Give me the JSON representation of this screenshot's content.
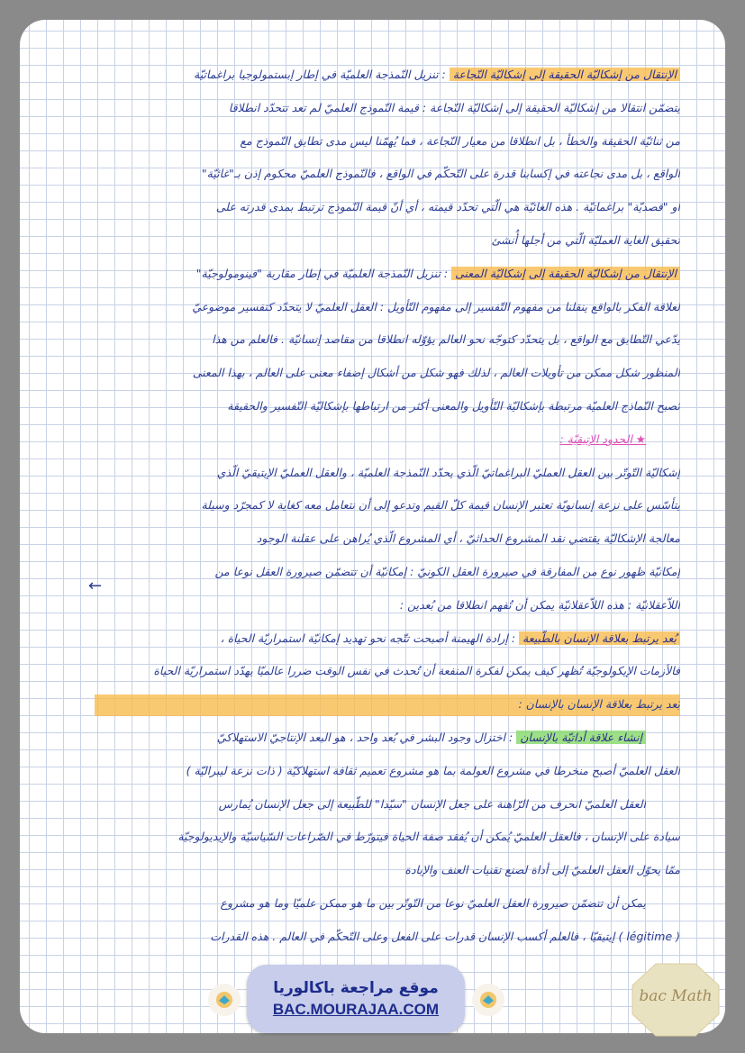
{
  "lines": [
    {
      "text": "الإنتقال من إشكاليّة الحقيقة إلى إشكاليّة النّجاعة : تنزيل النّمذجة العلميّة في إطار إبستمولوجيا براغماتيّة",
      "highlight": "الإنتقال من إشكاليّة الحقيقة إلى إشكاليّة النّجاعة"
    },
    {
      "text": "يتضمّن انتقالا من إشكاليّة الحقيقة إلى إشكاليّة النّجاعة : قيمة النّموذج العلميّ لم تعد تتحدّد انطلاقا"
    },
    {
      "text": "من ثنائيّة الحقيقة والخطأ ، بل انطلاقا من معيار النّجاعة ، فما يُهمّنا ليس مدى تطابق النّموذج مع"
    },
    {
      "text": "الواقع ، بل مدى نجاعته في إكسابنا قدرة على التّحكّم في الواقع ، فالنّموذج العلميّ محكوم إذن بـ\"غائيّة\""
    },
    {
      "text": "أو \"قصديّة\" براغماتيّة . هذه الغائيّة هي الّتي تحدّد قيمته ، أي أنّ قيمة النّموذج ترتبط بمدى قدرته على"
    },
    {
      "text": "تحقيق الغاية العمليّة الّتي من أجلها أُنشئ"
    },
    {
      "text": "الإنتقال من إشكاليّة الحقيقة إلى إشكاليّة المعنى : تنزيل النّمذجة العلميّة في إطار مقاربة \"فينومولوجيّة\"",
      "highlight": "الإنتقال من إشكاليّة الحقيقة إلى إشكاليّة المعنى"
    },
    {
      "text": "لعلاقة الفكر بالواقع ينقلنا من مفهوم التّفسير إلى مفهوم التّأويل : العقل العلميّ لا يتحدّد كتفسير موضوعيّ"
    },
    {
      "text": "يدّعي التّطابق مع الواقع ، بل يتحدّد كتوجّه نحو العالم يؤوّله انطلاقا من مقاصد إنسانيّة . فالعلم من هذا"
    },
    {
      "text": "المنظور شكل ممكن من تأويلات العالم ، لذلك فهو شكل من أشكال إضفاء معنى على العالم ، بهذا المعنى"
    },
    {
      "text": "تُصبح النّماذج العلميّة مرتبطة بإشكاليّة التّأويل والمعنى أكثر من ارتباطها بإشكاليّة التّفسير والحقيقة"
    },
    {
      "text": "★ الحدود الإتيقيّة :",
      "heading": true
    },
    {
      "text": "إشكاليّة التّوتّر بين العقل العمليّ البراغماتيّ الّذي يحدّد النّمذجة العلميّة ، والعقل العمليّ الإيتيقيّ الّذي"
    },
    {
      "text": "يتأسّس على نزعة إنسانويّة تعتبر الإنسان قيمة كلّ القيم وتدعو إلى أن نتعامل معه كغاية لا كمجرّد وسيلة"
    },
    {
      "text": "معالجة الإشكاليّة يقتضي نقد المشروع الحداثيّ ، أي المشروع الّذي يُراهن على عقلنة الوجود"
    },
    {
      "text": "إمكانيّة ظهور نوع من المفارقة في صيرورة العقل الكونيّ : إمكانيّة أن تتضمّن صيرورة العقل نوعا من",
      "arrow": true
    },
    {
      "text": "اللاّعقلانيّة : هذه اللاّعقلانيّة يمكن أن تُفهم انطلاقا من بُعدين :"
    },
    {
      "text": "بُعد يرتبط بعلاقة الإنسان بالطّبيعة : إرادة الهيمنة أصبحت تتّجه نحو تهديد إمكانيّة استمراريّة الحياة ،",
      "highlight": "بُعد يرتبط بعلاقة الإنسان بالطّبيعة"
    },
    {
      "text": "فالأزمات الإيكولوجيّة تُظهر كيف يمكن لفكرة المنفعة أن تُحدث في نفس الوقت ضررا عالميّا يهدّد استمراريّة الحياة"
    },
    {
      "text": "بُعد يرتبط بعلاقة الإنسان بالإنسان :",
      "bar": true
    },
    {
      "text": "إنشاء علاقة أداتيّة بالإنسان : اختزال وجود البشر في بُعد واحد ، هو البعد الإنتاجيّ الاستهلاكيّ",
      "highlight_green": "إنشاء علاقة أداتيّة بالإنسان",
      "bullet": true
    },
    {
      "text": "العقل العلميّ أصبح منخرطا في مشروع العولمة بما هو مشروع تعميم ثقافة استهلاكيّة ( ذات نزعة ليبراليّة )"
    },
    {
      "text": "العقل العلميّ انحرف من الرّاهنة على جعل الإنسان \"سيّدا\" للطّبيعة إلى جعل الإنسان يُمارس",
      "bullet": true
    },
    {
      "text": "سيادة على الإنسان ، فالعقل العلميّ يُمكن أن يُفقد صفة الحياة فيتورّط في الصّراعات السّياسيّة والإيديولوجيّة"
    },
    {
      "text": "ممّا يحوّل العقل العلميّ إلى أداة لصنع تقنيات العنف والإبادة"
    },
    {
      "text": "يمكن أن تتضمّن صيرورة العقل العلميّ نوعا من التّوتّر بين ما هو ممكن علميّا وما هو مشروع",
      "bullet": true
    },
    {
      "text": "( légitime ) إيتيقيّا ، فالعلم أكسب الإنسان قدرات على الفعل وعلى التّحكّم في العالم . هذه القدرات"
    }
  ],
  "footer": {
    "site_name": "موقع مراجعة  باكالوريا",
    "url": "BAC.MOURAJAA.COM"
  },
  "brand": {
    "logo_text": "bac Math",
    "colors": {
      "ink": "#2b3c93",
      "highlight_orange": "#f7bb4f",
      "highlight_green": "#8cdb72",
      "pink": "#e04fb3",
      "grid": "#c9d2e6",
      "frame": "#8a8a8a"
    }
  }
}
